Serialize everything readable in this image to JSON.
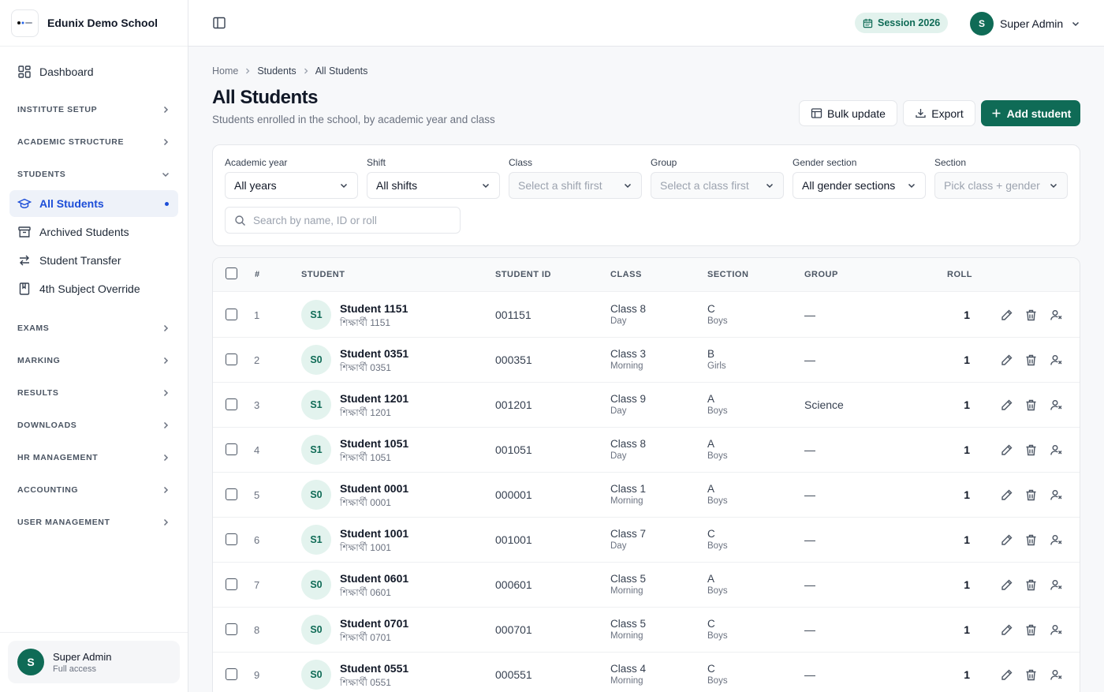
{
  "brand": {
    "name": "Edunix Demo School"
  },
  "sidebar": {
    "dashboard": "Dashboard",
    "sections": {
      "institute": "INSTITUTE SETUP",
      "academic": "ACADEMIC STRUCTURE",
      "students": "STUDENTS",
      "exams": "EXAMS",
      "marking": "MARKING",
      "results": "RESULTS",
      "downloads": "DOWNLOADS",
      "hr": "HR MANAGEMENT",
      "accounting": "ACCOUNTING",
      "user_mgmt": "USER MANAGEMENT"
    },
    "student_items": [
      "All Students",
      "Archived Students",
      "Student Transfer",
      "4th Subject Override"
    ],
    "footer": {
      "avatar": "S",
      "name": "Super Admin",
      "sub": "Full access"
    }
  },
  "topbar": {
    "session": "Session 2026",
    "user": {
      "avatar": "S",
      "name": "Super Admin"
    }
  },
  "breadcrumb": [
    "Home",
    "Students",
    "All Students"
  ],
  "page": {
    "title": "All Students",
    "subtitle": "Students enrolled in the school, by academic year and class"
  },
  "actions": {
    "bulk": "Bulk update",
    "export": "Export",
    "add": "Add student"
  },
  "filters": {
    "academic_year": {
      "label": "Academic year",
      "value": "All years"
    },
    "shift": {
      "label": "Shift",
      "value": "All shifts"
    },
    "class": {
      "label": "Class",
      "value": "Select a shift first"
    },
    "group": {
      "label": "Group",
      "value": "Select a class first"
    },
    "gender_section": {
      "label": "Gender section",
      "value": "All gender sections"
    },
    "section": {
      "label": "Section",
      "value": "Pick class + gender"
    },
    "search_placeholder": "Search by name, ID or roll"
  },
  "table": {
    "headers": {
      "num": "#",
      "student": "STUDENT",
      "student_id": "STUDENT ID",
      "class": "CLASS",
      "section": "SECTION",
      "group": "GROUP",
      "roll": "ROLL"
    },
    "rows": [
      {
        "num": "1",
        "initials": "S1",
        "name": "Student 1151",
        "bn_name": "শিক্ষার্থী 1151",
        "id": "001151",
        "class": "Class 8",
        "shift": "Day",
        "section": "C",
        "gender": "Boys",
        "group": "—",
        "roll": "1"
      },
      {
        "num": "2",
        "initials": "S0",
        "name": "Student 0351",
        "bn_name": "শিক্ষার্থী 0351",
        "id": "000351",
        "class": "Class 3",
        "shift": "Morning",
        "section": "B",
        "gender": "Girls",
        "group": "—",
        "roll": "1"
      },
      {
        "num": "3",
        "initials": "S1",
        "name": "Student 1201",
        "bn_name": "শিক্ষার্থী 1201",
        "id": "001201",
        "class": "Class 9",
        "shift": "Day",
        "section": "A",
        "gender": "Boys",
        "group": "Science",
        "roll": "1"
      },
      {
        "num": "4",
        "initials": "S1",
        "name": "Student 1051",
        "bn_name": "শিক্ষার্থী 1051",
        "id": "001051",
        "class": "Class 8",
        "shift": "Day",
        "section": "A",
        "gender": "Boys",
        "group": "—",
        "roll": "1"
      },
      {
        "num": "5",
        "initials": "S0",
        "name": "Student 0001",
        "bn_name": "শিক্ষার্থী 0001",
        "id": "000001",
        "class": "Class 1",
        "shift": "Morning",
        "section": "A",
        "gender": "Boys",
        "group": "—",
        "roll": "1"
      },
      {
        "num": "6",
        "initials": "S1",
        "name": "Student 1001",
        "bn_name": "শিক্ষার্থী 1001",
        "id": "001001",
        "class": "Class 7",
        "shift": "Day",
        "section": "C",
        "gender": "Boys",
        "group": "—",
        "roll": "1"
      },
      {
        "num": "7",
        "initials": "S0",
        "name": "Student 0601",
        "bn_name": "শিক্ষার্থী 0601",
        "id": "000601",
        "class": "Class 5",
        "shift": "Morning",
        "section": "A",
        "gender": "Boys",
        "group": "—",
        "roll": "1"
      },
      {
        "num": "8",
        "initials": "S0",
        "name": "Student 0701",
        "bn_name": "শিক্ষার্থী 0701",
        "id": "000701",
        "class": "Class 5",
        "shift": "Morning",
        "section": "C",
        "gender": "Boys",
        "group": "—",
        "roll": "1"
      },
      {
        "num": "9",
        "initials": "S0",
        "name": "Student 0551",
        "bn_name": "শিক্ষার্থী 0551",
        "id": "000551",
        "class": "Class 4",
        "shift": "Morning",
        "section": "C",
        "gender": "Boys",
        "group": "—",
        "roll": "1"
      }
    ]
  },
  "colors": {
    "brand": "#0f6b56",
    "active": "#1d4ed8",
    "brand_soft": "#e3f3ee"
  }
}
